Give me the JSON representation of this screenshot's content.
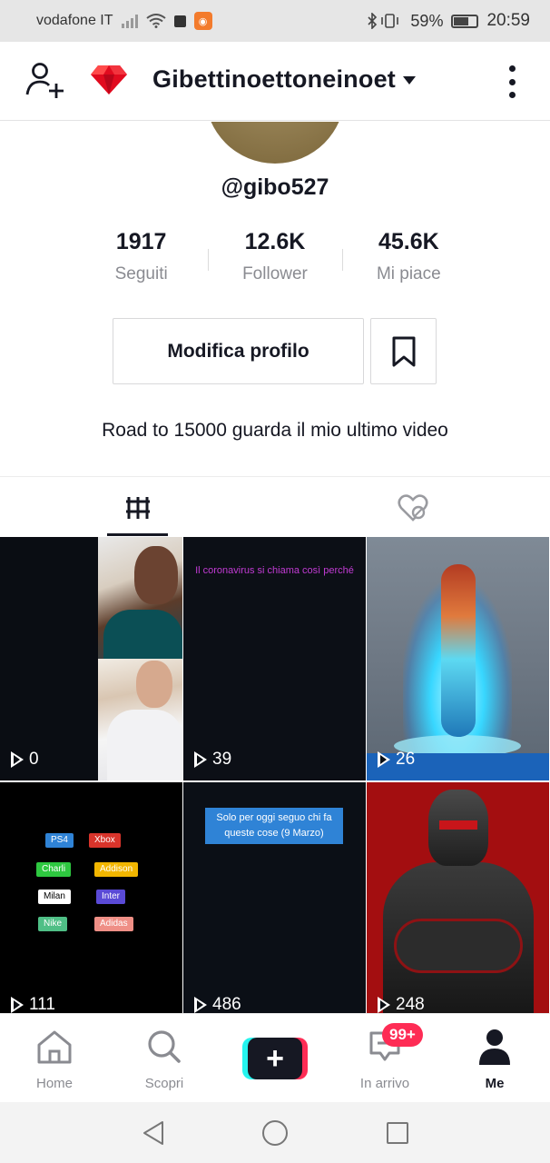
{
  "status_bar": {
    "carrier": "vodafone IT",
    "battery_percent": "59%",
    "time": "20:59"
  },
  "header": {
    "username": "Gibettinoettoneinoet"
  },
  "profile": {
    "handle": "@gibo527",
    "stats": [
      {
        "value": "1917",
        "label": "Seguiti"
      },
      {
        "value": "12.6K",
        "label": "Follower"
      },
      {
        "value": "45.6K",
        "label": "Mi piace"
      }
    ],
    "edit_label": "Modifica profilo",
    "bio": "Road to 15000 guarda il mio ultimo video"
  },
  "videos": [
    {
      "views": "0"
    },
    {
      "views": "39",
      "caption": "Il coronavirus si chiama così perché"
    },
    {
      "views": "26"
    },
    {
      "views": "111",
      "tags": [
        "PS4",
        "Xbox",
        "Charli",
        "Addison",
        "Milan",
        "Inter",
        "Nike",
        "Adidas"
      ]
    },
    {
      "views": "486",
      "caption": "Solo per oggi seguo chi fa queste cose (9 Marzo)"
    },
    {
      "views": "248"
    }
  ],
  "bottom_nav": {
    "home": "Home",
    "discover": "Scopri",
    "inbox": "In arrivo",
    "inbox_badge": "99+",
    "me": "Me"
  },
  "colors": {
    "accent_red": "#fe2c55",
    "accent_cyan": "#25f4ee",
    "text": "#161823",
    "muted": "#8a8b91"
  }
}
